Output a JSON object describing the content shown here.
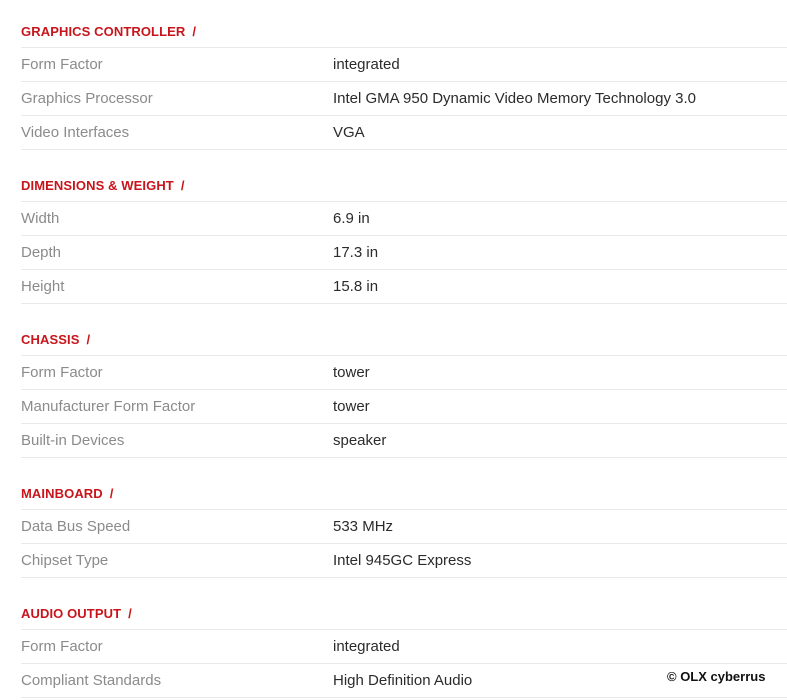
{
  "sections": [
    {
      "title": "GRAPHICS CONTROLLER",
      "separator": "/",
      "rows": [
        {
          "label": "Form Factor",
          "value": "integrated"
        },
        {
          "label": "Graphics Processor",
          "value": "Intel GMA 950 Dynamic Video Memory Technology 3.0"
        },
        {
          "label": "Video Interfaces",
          "value": "VGA"
        }
      ]
    },
    {
      "title": "DIMENSIONS & WEIGHT",
      "separator": "/",
      "rows": [
        {
          "label": "Width",
          "value": "6.9 in"
        },
        {
          "label": "Depth",
          "value": "17.3 in"
        },
        {
          "label": "Height",
          "value": "15.8 in"
        }
      ]
    },
    {
      "title": "CHASSIS",
      "separator": "/",
      "rows": [
        {
          "label": "Form Factor",
          "value": "tower"
        },
        {
          "label": "Manufacturer Form Factor",
          "value": "tower"
        },
        {
          "label": "Built-in Devices",
          "value": "speaker"
        }
      ]
    },
    {
      "title": "MAINBOARD",
      "separator": "/",
      "rows": [
        {
          "label": "Data Bus Speed",
          "value": "533 MHz"
        },
        {
          "label": "Chipset Type",
          "value": "Intel 945GC Express"
        }
      ]
    },
    {
      "title": "AUDIO OUTPUT",
      "separator": "/",
      "rows": [
        {
          "label": "Form Factor",
          "value": "integrated"
        },
        {
          "label": "Compliant Standards",
          "value": "High Definition Audio"
        }
      ]
    }
  ],
  "watermark": "© OLX cyberrus",
  "colors": {
    "section_title": "#c8151b",
    "label": "#8b8b8b",
    "value": "#2b2b2b",
    "divider": "#e9e9e9"
  }
}
